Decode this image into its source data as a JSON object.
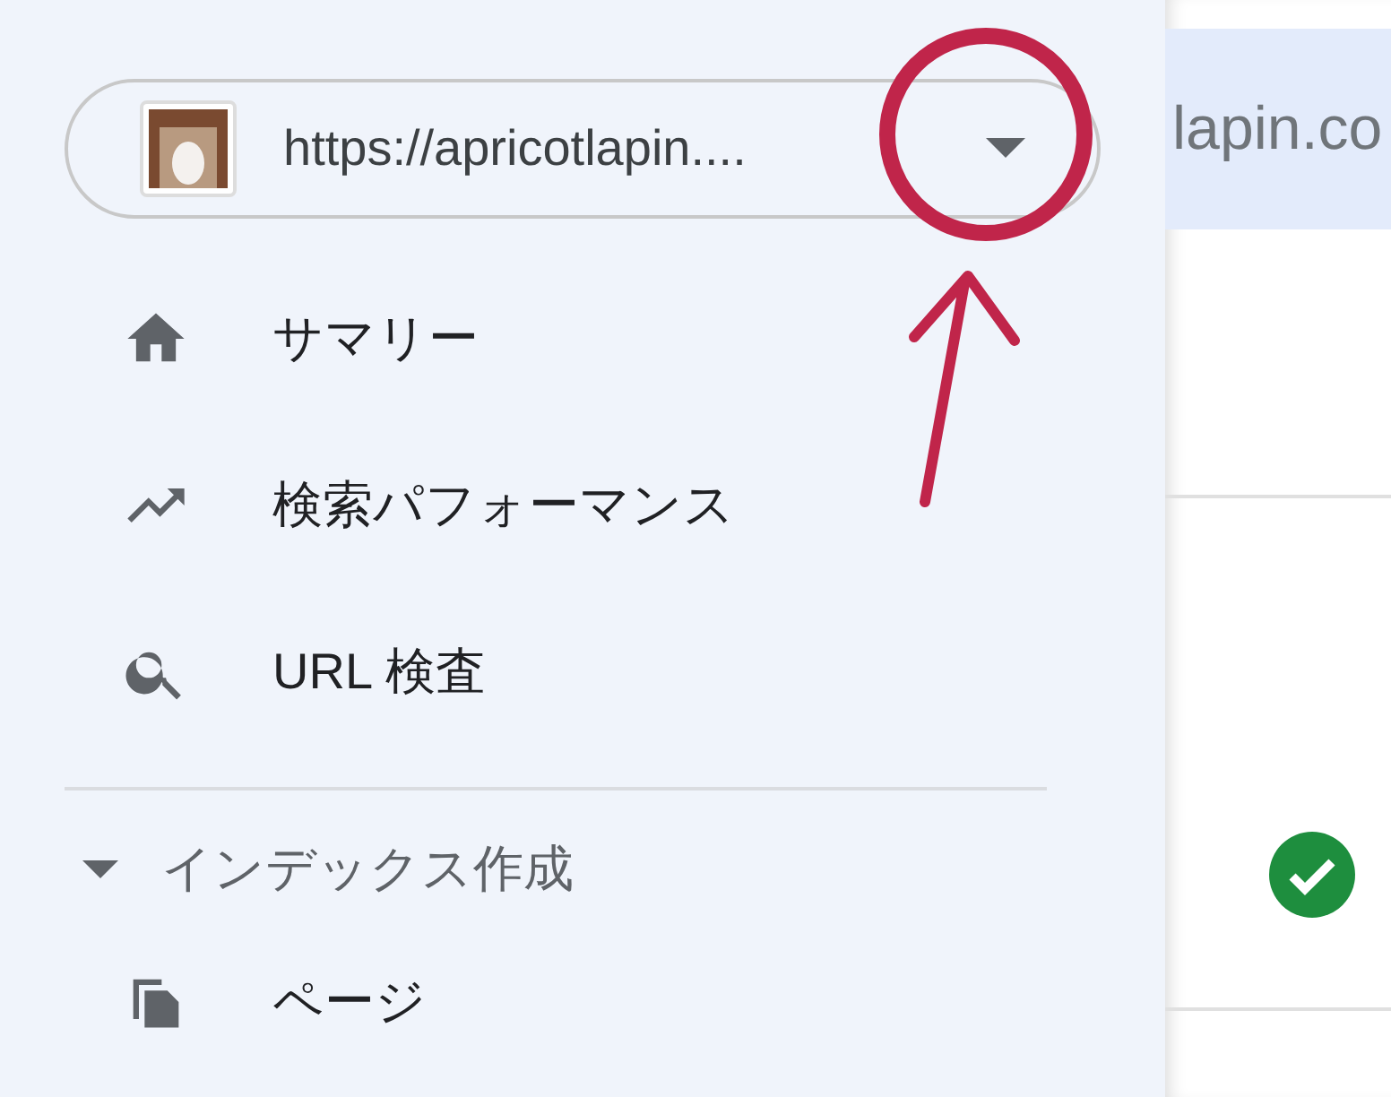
{
  "property_selector": {
    "url": "https://apricotlapin....",
    "expanded": false
  },
  "nav_items": [
    {
      "kind": "home",
      "label": "サマリー",
      "selected": false
    },
    {
      "kind": "trend",
      "label": "検索パフォーマンス",
      "selected": false
    },
    {
      "kind": "search",
      "label": "URL 検査",
      "selected": false
    }
  ],
  "sections": [
    {
      "label": "インデックス作成",
      "expanded": true,
      "items": [
        {
          "kind": "pages",
          "label": "ページ",
          "selected": false
        }
      ]
    }
  ],
  "main": {
    "header_text": "lapin.co",
    "status_ok": true
  }
}
